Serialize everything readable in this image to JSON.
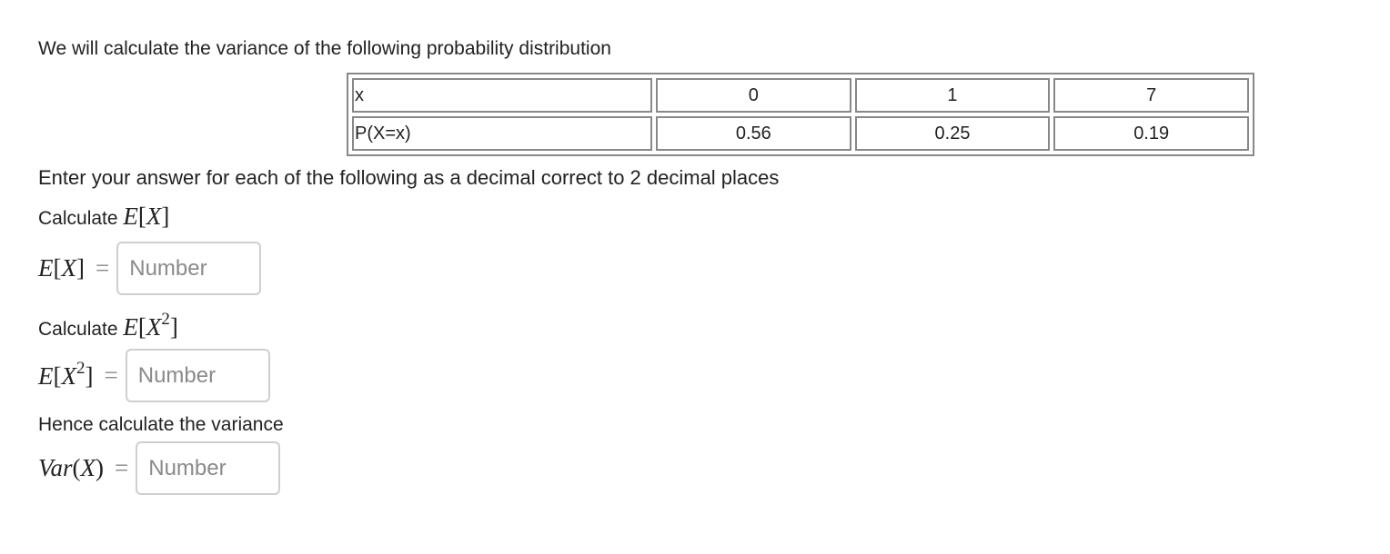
{
  "intro_text": "We will calculate the variance of the following probability distribution",
  "table": {
    "rows": [
      {
        "label": "x",
        "values": [
          "0",
          "1",
          "7"
        ]
      },
      {
        "label": "P(X=x)",
        "values": [
          "0.56",
          "0.25",
          "0.19"
        ]
      }
    ]
  },
  "instruction_text": "Enter your answer for each of the following as a decimal correct to 2 decimal places",
  "questions": [
    {
      "prompt": "Calculate",
      "math_prompt": "E[X]",
      "lhs": "E[X]",
      "equals": "=",
      "input_value": "",
      "placeholder": "Number"
    },
    {
      "prompt": "Calculate",
      "math_prompt": "E[X^2]",
      "lhs": "E[X^2]",
      "equals": "=",
      "input_value": "",
      "placeholder": "Number"
    },
    {
      "prompt": "Hence calculate the variance",
      "lhs": "Var(X)",
      "equals": "=",
      "input_value": "",
      "placeholder": "Number"
    }
  ]
}
